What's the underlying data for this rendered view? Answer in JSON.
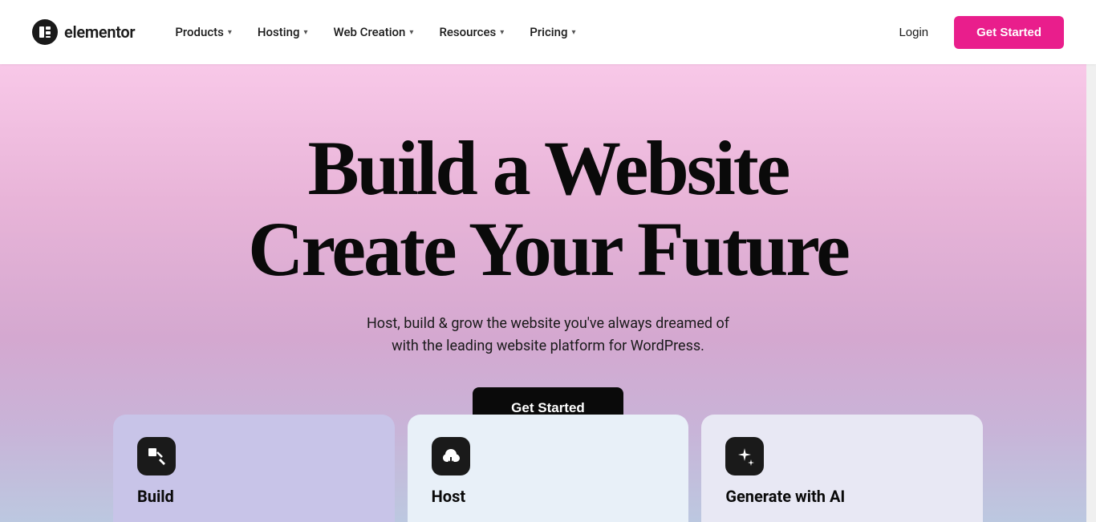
{
  "brand": {
    "logo_letter": "e",
    "logo_name": "elementor"
  },
  "nav": {
    "items": [
      {
        "label": "Products",
        "has_dropdown": true
      },
      {
        "label": "Hosting",
        "has_dropdown": true
      },
      {
        "label": "Web Creation",
        "has_dropdown": true
      },
      {
        "label": "Resources",
        "has_dropdown": true
      },
      {
        "label": "Pricing",
        "has_dropdown": true
      }
    ],
    "login_label": "Login",
    "get_started_label": "Get Started"
  },
  "hero": {
    "title_line1": "Build a Website",
    "title_line2": "Create Your Future",
    "subtitle_line1": "Host, build & grow the website you've always dreamed of",
    "subtitle_line2": "with the leading website platform for WordPress.",
    "cta_label": "Get Started"
  },
  "cards": [
    {
      "id": "build",
      "label": "Build",
      "icon": "build-icon",
      "icon_symbol": "⬛",
      "bg_color": "#c8c4e8"
    },
    {
      "id": "host",
      "label": "Host",
      "icon": "host-icon",
      "icon_symbol": "☁",
      "bg_color": "#ddeaf8"
    },
    {
      "id": "ai",
      "label": "Generate with AI",
      "icon": "ai-icon",
      "icon_symbol": "✦",
      "bg_color": "#e8e8f4"
    }
  ]
}
